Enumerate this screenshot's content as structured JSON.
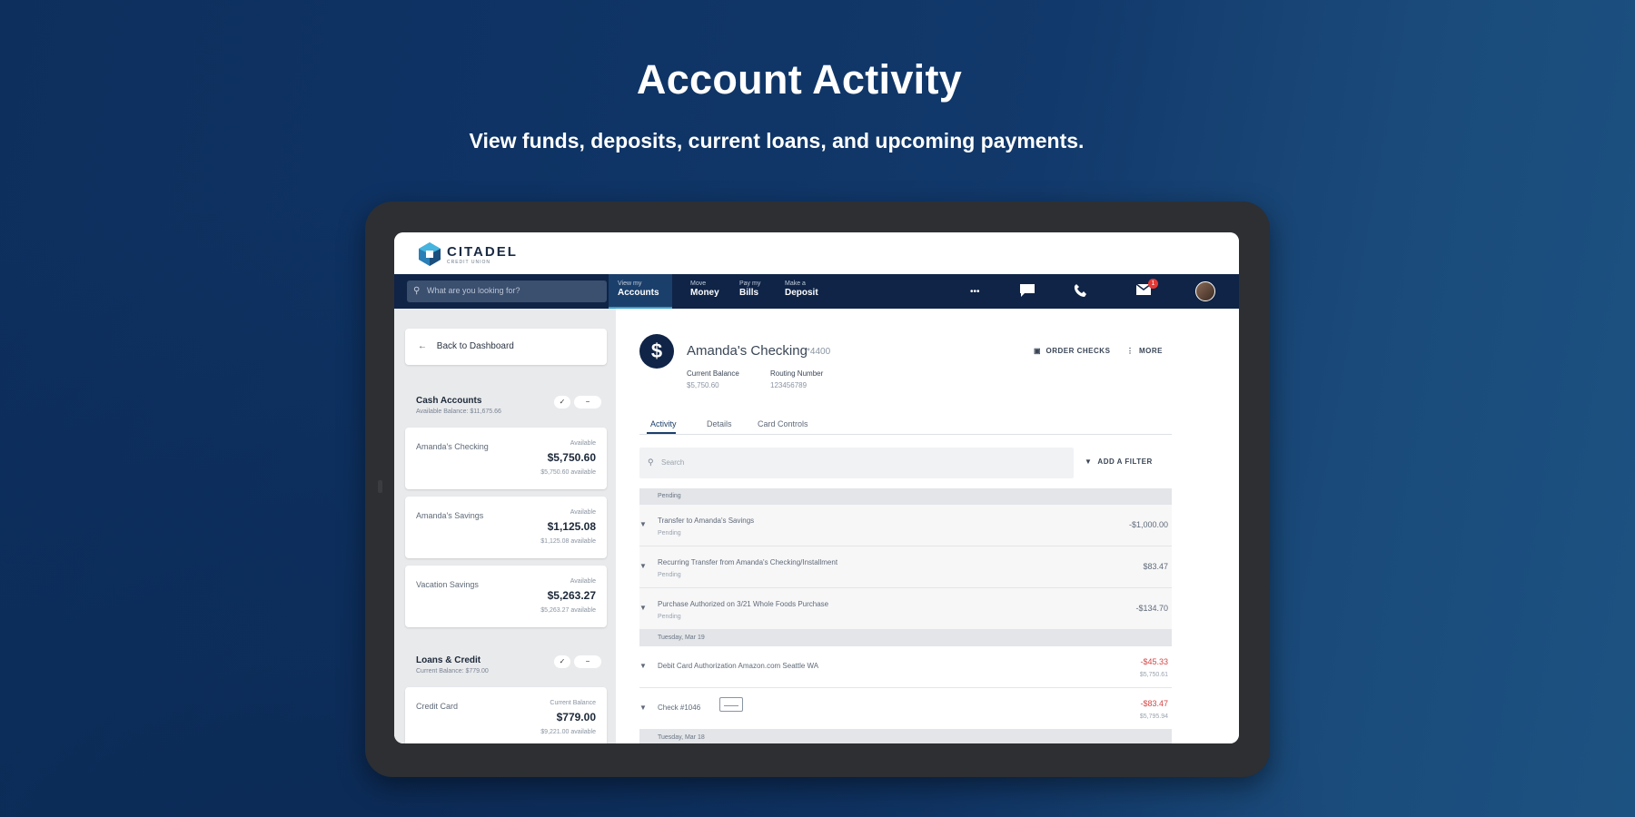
{
  "marketing": {
    "headline": "Account Activity",
    "subhead": "View funds, deposits, current loans, and upcoming payments."
  },
  "brand": {
    "name": "CITADEL",
    "tagline": "CREDIT UNION"
  },
  "nav": {
    "search_placeholder": "What are you looking for?",
    "items": [
      {
        "small": "View my",
        "big": "Accounts",
        "active": true
      },
      {
        "small": "Move",
        "big": "Money"
      },
      {
        "small": "Pay my",
        "big": "Bills"
      },
      {
        "small": "Make a",
        "big": "Deposit"
      }
    ],
    "more": "•••",
    "notification_count": "1"
  },
  "sidebar": {
    "back_label": "Back to Dashboard",
    "cash": {
      "title": "Cash Accounts",
      "subtitle": "Available Balance: $11,675.66",
      "accounts": [
        {
          "name": "Amanda's Checking",
          "label": "Available",
          "amount": "$5,750.60",
          "avail": "$5,750.60 available"
        },
        {
          "name": "Amanda's Savings",
          "label": "Available",
          "amount": "$1,125.08",
          "avail": "$1,125.08 available"
        },
        {
          "name": "Vacation Savings",
          "label": "Available",
          "amount": "$5,263.27",
          "avail": "$5,263.27 available"
        }
      ]
    },
    "loans": {
      "title": "Loans & Credit",
      "subtitle": "Current Balance: $779.00",
      "accounts": [
        {
          "name": "Credit Card",
          "label": "Current Balance",
          "amount": "$779.00",
          "avail": "$9,221.00 available"
        }
      ]
    }
  },
  "account": {
    "icon": "$",
    "title": "Amanda's Checking",
    "mask": "*4400",
    "actions": {
      "order_checks": "ORDER CHECKS",
      "more": "MORE"
    },
    "stats": [
      {
        "label": "Current Balance",
        "value": "$5,750.60"
      },
      {
        "label": "Routing Number",
        "value": "123456789"
      }
    ],
    "tabs": [
      "Activity",
      "Details",
      "Card Controls"
    ],
    "search_placeholder": "Search",
    "filter_label": "ADD A FILTER"
  },
  "activity": {
    "groups": [
      {
        "header": "Pending",
        "rows": [
          {
            "desc": "Transfer to Amanda's Savings",
            "status": "Pending",
            "amount": "-$1,000.00",
            "red": false
          },
          {
            "desc": "Recurring Transfer from Amanda's Checking/Installment",
            "status": "Pending",
            "amount": "$83.47",
            "red": false
          },
          {
            "desc": "Purchase Authorized on 3/21 Whole Foods Purchase",
            "status": "Pending",
            "amount": "-$134.70",
            "red": false
          }
        ]
      },
      {
        "header": "Tuesday, Mar 19",
        "rows": [
          {
            "desc": "Debit Card Authorization Amazon.com Seattle WA",
            "amount": "-$45.33",
            "balance": "$5,750.61",
            "red": true
          },
          {
            "desc": "Check #1046",
            "amount": "-$83.47",
            "balance": "$5,795.94",
            "red": true,
            "check": true
          }
        ]
      },
      {
        "header": "Tuesday, Mar 18"
      }
    ]
  },
  "colors": {
    "navy": "#0f2447",
    "accent": "#35a1c9",
    "debit_red": "#d64545"
  }
}
